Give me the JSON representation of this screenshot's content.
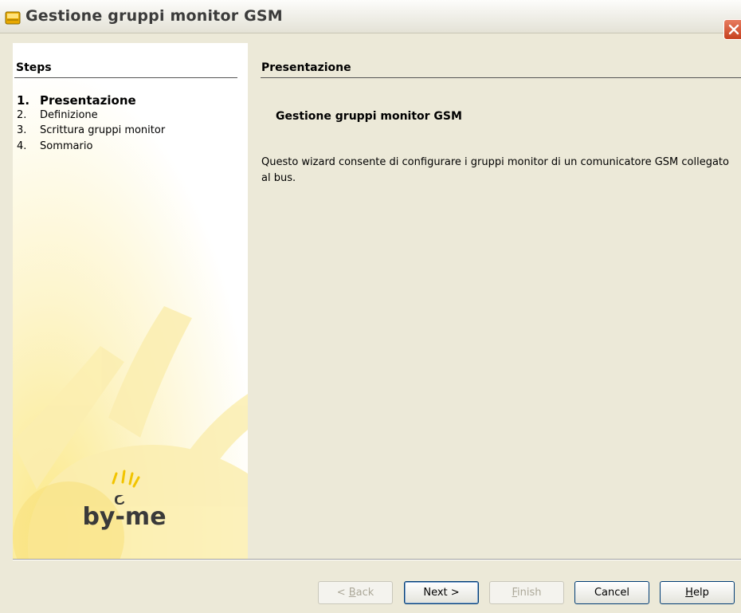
{
  "window": {
    "title": "Gestione gruppi monitor GSM"
  },
  "steps_panel": {
    "title": "Steps",
    "items": [
      {
        "number": "1.",
        "label": "Presentazione",
        "active": true
      },
      {
        "number": "2.",
        "label": "Definizione",
        "active": false
      },
      {
        "number": "3.",
        "label": "Scrittura gruppi monitor",
        "active": false
      },
      {
        "number": "4.",
        "label": "Sommario",
        "active": false
      }
    ],
    "logo_text": "by-me"
  },
  "content": {
    "panel_title": "Presentazione",
    "heading": "Gestione gruppi monitor GSM",
    "description": "Questo wizard consente di configurare i gruppi monitor di un comunicatore GSM collegato al bus."
  },
  "buttons": {
    "back": {
      "prefix": "< ",
      "mnemonic": "B",
      "rest": "ack",
      "enabled": false
    },
    "next": {
      "label": "Next >",
      "enabled": true
    },
    "finish": {
      "mnemonic": "F",
      "rest": "inish",
      "enabled": false
    },
    "cancel": {
      "label": "Cancel",
      "enabled": true
    },
    "help": {
      "mnemonic": "H",
      "rest": "elp",
      "enabled": true
    }
  },
  "colors": {
    "dialog_bg": "#ece9d8",
    "close_button": "#d9532c",
    "logo_accent": "#f2c400"
  }
}
